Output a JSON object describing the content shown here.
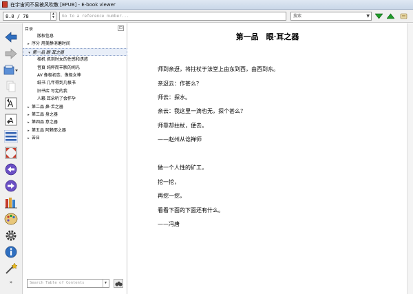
{
  "window": {
    "title": "在宇宙间不易被风吹散 [EPUB] - E-book viewer"
  },
  "toolbar": {
    "page_value": "8.0 / 78",
    "reference_placeholder": "Go to a reference number...",
    "search_value": "搜索"
  },
  "toc": {
    "header": "目录",
    "close": "⊡",
    "items": [
      {
        "label": "版权信息",
        "caret": "",
        "level": 1,
        "selected": false
      },
      {
        "label": "序分 用美静消磨时间",
        "caret": "▸",
        "level": 0,
        "selected": false
      },
      {
        "label": "第一品 眼·耳之器",
        "caret": "▾",
        "level": 0,
        "selected": true
      },
      {
        "label": "相机 抓到时女的性感和诱惑",
        "caret": "",
        "level": 1,
        "selected": false
      },
      {
        "label": "音頁 纯粹而丰腴的闻光",
        "caret": "",
        "level": 1,
        "selected": false
      },
      {
        "label": "AV 像极初恋、像极女神",
        "caret": "",
        "level": 1,
        "selected": false
      },
      {
        "label": "纸书 几年得到几根书",
        "caret": "",
        "level": 1,
        "selected": false
      },
      {
        "label": "旧书店 写定的我",
        "caret": "",
        "level": 1,
        "selected": false
      },
      {
        "label": "人籁 耳朵听了会怀孕",
        "caret": "",
        "level": 1,
        "selected": false
      },
      {
        "label": "第二品 鼻·舌之器",
        "caret": "▸",
        "level": 0,
        "selected": false
      },
      {
        "label": "第三品 身之器",
        "caret": "▸",
        "level": 0,
        "selected": false
      },
      {
        "label": "第四品 意之器",
        "caret": "▸",
        "level": 0,
        "selected": false
      },
      {
        "label": "第五品 阿赖耶之器",
        "caret": "▸",
        "level": 0,
        "selected": false
      },
      {
        "label": "苦日",
        "caret": "▸",
        "level": 0,
        "selected": false
      }
    ],
    "search_placeholder": "Search Table of Contents"
  },
  "book": {
    "title": "第一品　眼·耳之器",
    "lines": [
      "师到亲迓，将拄杖于法堂上由东到西，由西到东。",
      "亲迓云：作甚么？",
      "师云：探水。",
      "亲云：我这里一滴也无，探个甚么？",
      "师靠却拄杖，便去。",
      "——赵州从谂禅师",
      "做一个人性的矿工，",
      "挖一挖，",
      "再挖一挖，",
      "看看下面的下面还有什么。",
      "——冯唐"
    ]
  },
  "colors": {
    "accent_blue": "#2f6fc0",
    "arrow_green": "#1f9a2a",
    "title_red": "#c53a2a"
  }
}
